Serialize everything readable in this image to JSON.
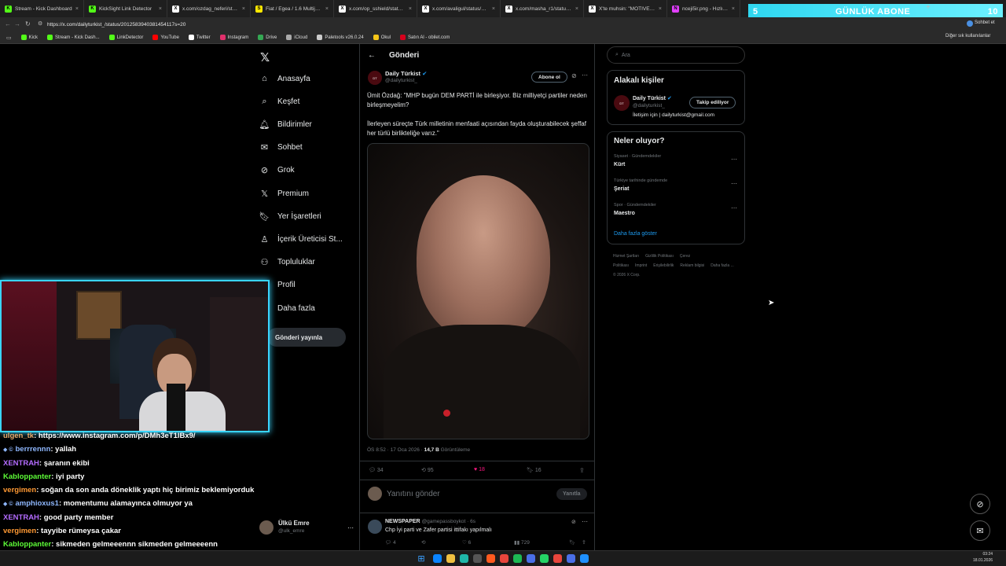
{
  "browser": {
    "tabs": [
      {
        "label": "Stream - Kick Dashboard",
        "color": "#53fc18",
        "glyph": "K"
      },
      {
        "label": "KickSight Link Detector",
        "color": "#53fc18",
        "glyph": "K"
      },
      {
        "label": "x.com/ozdag_neferi/status/2…",
        "color": "#ffffff",
        "glyph": "X"
      },
      {
        "label": "Fiat / Egea / 1.6 Multijet / Lo…",
        "color": "#ffe800",
        "glyph": "S"
      },
      {
        "label": "x.com/op_sshield/status/201…",
        "color": "#ffffff",
        "glyph": "X"
      },
      {
        "label": "x.com/avaligul/status/20124…",
        "color": "#ffffff",
        "glyph": "X"
      },
      {
        "label": "x.com/masha_r1/status/2012…",
        "color": "#ffffff",
        "glyph": "X"
      },
      {
        "label": "X'te muhsin: \"MOTIVE YILDI…",
        "color": "#ffffff",
        "glyph": "X"
      },
      {
        "label": "nceji5ir.png - Hızlı Resim",
        "color": "#e040fb",
        "glyph": "N"
      }
    ],
    "tab_close": "×",
    "url": "https://x.com/dailyturkist_/status/2012583940381454117s=20",
    "window_controls": [
      "–",
      "□",
      "✕"
    ],
    "profile_label": "Sohbet et",
    "bookmarks": [
      {
        "label": "Kick",
        "color": "#53fc18"
      },
      {
        "label": "Stream - Kick Dash...",
        "color": "#53fc18"
      },
      {
        "label": "LinkDetector",
        "color": "#53fc18"
      },
      {
        "label": "YouTube",
        "color": "#ff0000"
      },
      {
        "label": "Twitter",
        "color": "#ffffff"
      },
      {
        "label": "Instagram",
        "color": "#e1306c"
      },
      {
        "label": "Drive",
        "color": "#34a853"
      },
      {
        "label": "iCloud",
        "color": "#aaaaaa"
      },
      {
        "label": "Paletools v26.0.24",
        "color": "#cccccc"
      },
      {
        "label": "Okul",
        "color": "#f5c518"
      },
      {
        "label": "Satın Al - obilet.com",
        "color": "#d6001c"
      }
    ],
    "other_bookmarks": "Diğer sık kullanılanlar"
  },
  "overlay": {
    "abone_left": "5",
    "abone_label": "GÜNLÜK ABONE",
    "abone_right": "10"
  },
  "nav": {
    "items": [
      {
        "label": "Anasayfa",
        "icon": "home-icon",
        "glyph": "⌂"
      },
      {
        "label": "Keşfet",
        "icon": "search-icon",
        "glyph": "⌕"
      },
      {
        "label": "Bildirimler",
        "icon": "bell-icon",
        "glyph": "🔔︎"
      },
      {
        "label": "Sohbet",
        "icon": "mail-icon",
        "glyph": "✉"
      },
      {
        "label": "Grok",
        "icon": "grok-icon",
        "glyph": "⊘"
      },
      {
        "label": "Premium",
        "icon": "x-icon",
        "glyph": "𝕏"
      },
      {
        "label": "Yer İşaretleri",
        "icon": "bookmark-icon",
        "glyph": "🔖︎"
      },
      {
        "label": "İçerik Üreticisi St...",
        "icon": "creator-icon",
        "glyph": "♙"
      },
      {
        "label": "Topluluklar",
        "icon": "communities-icon",
        "glyph": "⚇"
      },
      {
        "label": "Profil",
        "icon": "profile-icon",
        "glyph": "☺"
      },
      {
        "label": "Daha fazla",
        "icon": "more-icon",
        "glyph": "⋯"
      }
    ],
    "post_button": "Gönderi yayınla",
    "me_name": "Ülkü Emre",
    "me_handle": "@ulk_emre",
    "logo": "𝕏"
  },
  "post": {
    "header": "Gönderi",
    "author": "Daily Türkist",
    "handle": "@dailyturkist_",
    "subscribe": "Abone ol",
    "text1": "Ümit Özdağ: \"MHP bugün DEM PARTİ ile birleşiyor. Biz milliyetçi partiler neden birleşmeyelim?",
    "text2": "İlerleyen süreçte Türk milletinin menfaati açısından fayda oluşturabilecek şeffaf her türlü birlikteliğe varız.\"",
    "time": "ÖS 8:52 · 17 Oca 2026 · ",
    "views": "14,7 B",
    "views_label": " Görüntüleme",
    "replies": "34",
    "reposts": "95",
    "likes": "18",
    "bookmarks": "16",
    "reply_placeholder": "Yanıtını gönder",
    "reply_button": "Yanıtla"
  },
  "reply": {
    "author": "NEWSPAPER",
    "handle": "@gamepassboykot · 6s",
    "text": "Chp İyi parti ve Zafer partisi ittifakı yapılmalı",
    "replies": "4",
    "reposts": "",
    "likes": "6",
    "views": "729"
  },
  "right": {
    "search_placeholder": "Ara",
    "related_title": "Alakalı kişiler",
    "related_name": "Daily Türkist",
    "related_handle": "@dailyturkist_",
    "related_bio": "İletişim için | dailyturkist@gmail.com",
    "following": "Takip ediliyor",
    "trends_title": "Neler oluyor?",
    "trends": [
      {
        "cat": "Siyaset · Gündemdekiler",
        "topic": "Kürt"
      },
      {
        "cat": "Türkiye tarihinde gündemde",
        "topic": "Şeriat"
      },
      {
        "cat": "Spor · Gündemdekiler",
        "topic": "Maestro"
      }
    ],
    "show_more": "Daha fazla göster",
    "footer": [
      "Hizmet Şartları",
      "Gizlilik Politikası",
      "Çerez Politikası",
      "Imprint",
      "Erişilebilirlik",
      "Reklam bilgisi",
      "Daha fazla ..."
    ],
    "copyright": "© 2026 X Corp."
  },
  "chat": [
    {
      "user": "ulgen_tk",
      "color": "#e8a96a",
      "badge": "",
      "msg": ": https://www.instagram.com/p/DMh3eT1lBx9/"
    },
    {
      "user": "berrrennn",
      "color": "#8fb8ff",
      "badge": "◆ ©",
      "msg": ": yallah"
    },
    {
      "user": "XENTRAH",
      "color": "#b46cff",
      "badge": "",
      "msg": ": şaranın ekibi"
    },
    {
      "user": "Kabloppanter",
      "color": "#5dfc37",
      "badge": "",
      "msg": ": iyi party"
    },
    {
      "user": "vergimen",
      "color": "#ff9933",
      "badge": "",
      "msg": ": soğan da son anda döneklik yaptı hiç birimiz beklemiyorduk"
    },
    {
      "user": "amphioxus1",
      "color": "#8fb8ff",
      "badge": "◆ ©",
      "msg": ": momentumu alamayınca olmuyor ya"
    },
    {
      "user": "XENTRAH",
      "color": "#b46cff",
      "badge": "",
      "msg": ": good party member"
    },
    {
      "user": "vergimen",
      "color": "#ff9933",
      "badge": "",
      "msg": ": tayyibe rümeysa çakar"
    },
    {
      "user": "Kabloppanter",
      "color": "#5dfc37",
      "badge": "",
      "msg": ": sikmeden gelmeeennn sikmeden gelmeeeenn"
    }
  ],
  "taskbar": {
    "time": "03:24",
    "date": "18.01.2026",
    "apps": [
      "#0a84ff",
      "#f0c040",
      "#1fb6a8",
      "#555555",
      "#ff5a1f",
      "#e8453c",
      "#1db954",
      "#4a6fe8",
      "#25d366",
      "#e8453c",
      "#4a6fe8",
      "#1e90ff"
    ]
  }
}
